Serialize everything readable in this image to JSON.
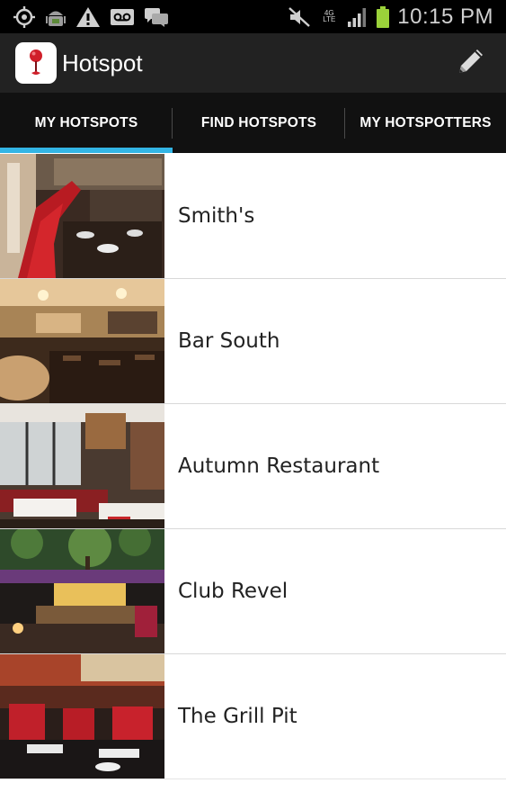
{
  "status_bar": {
    "time": "10:15 PM",
    "network": "4G LTE",
    "icons": [
      "gps-icon",
      "android-debug-icon",
      "warning-icon",
      "voicemail-icon",
      "messages-icon",
      "mute-icon",
      "signal-icon",
      "battery-icon"
    ]
  },
  "action_bar": {
    "title": "Hotspot",
    "icon": "hotspot-pin-icon",
    "action_icon": "edit-pencil-icon"
  },
  "tabs": [
    {
      "label": "MY HOTSPOTS",
      "selected": true
    },
    {
      "label": "FIND HOTSPOTS",
      "selected": false
    },
    {
      "label": "MY HOTSPOTTERS",
      "selected": false
    }
  ],
  "colors": {
    "accent": "#33b5e5",
    "action_bar": "#222222",
    "tab_bar": "#111111",
    "pin_red": "#d01f2a"
  },
  "hotspots": [
    {
      "name": "Smith's",
      "thumbnail": "restaurant-red-booths-photo"
    },
    {
      "name": "Bar South",
      "thumbnail": "bar-interior-photo"
    },
    {
      "name": "Autumn Restaurant",
      "thumbnail": "dining-room-photo"
    },
    {
      "name": "Club Revel",
      "thumbnail": "club-patio-photo"
    },
    {
      "name": "The Grill Pit",
      "thumbnail": "grill-restaurant-photo"
    }
  ]
}
